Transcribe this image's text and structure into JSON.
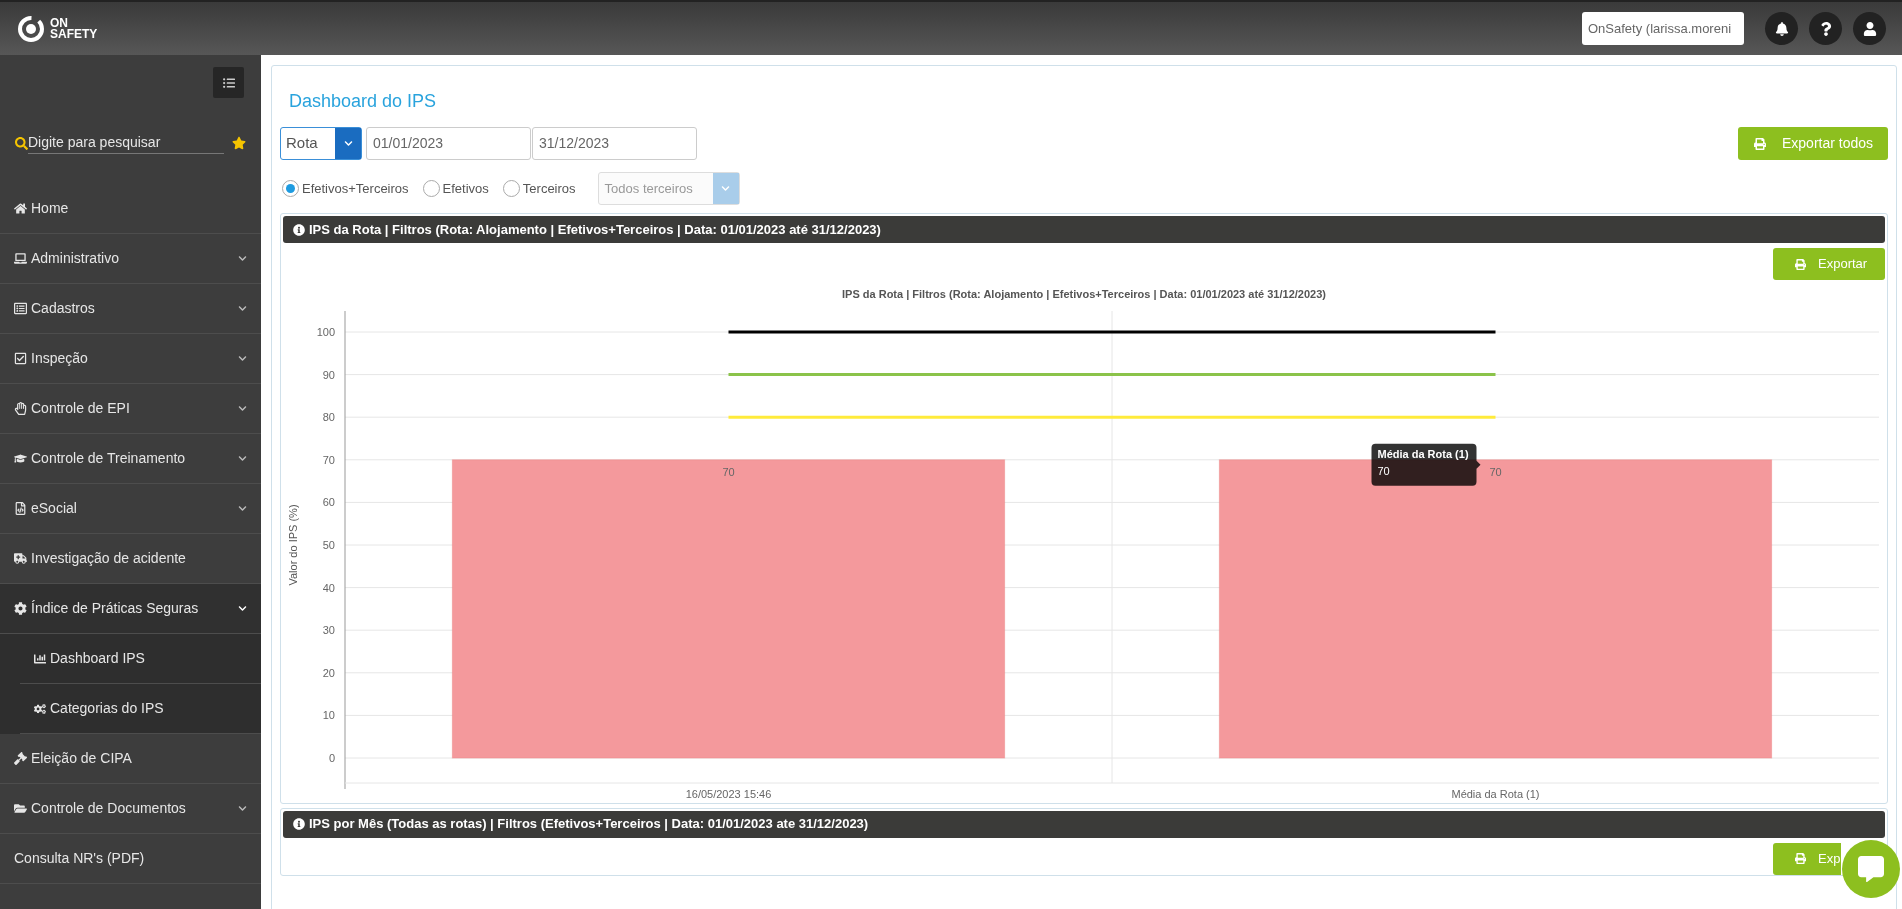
{
  "topbar": {
    "logo_lines": [
      "ON",
      "SAFETY"
    ],
    "user": "OnSafety (larissa.moreni"
  },
  "sidebar": {
    "search": {
      "placeholder": "Digite para pesquisar"
    },
    "items": [
      {
        "label": "Home"
      },
      {
        "label": "Administrativo",
        "expanded": false
      },
      {
        "label": "Cadastros",
        "expanded": false
      },
      {
        "label": "Inspeção",
        "expanded": false
      },
      {
        "label": "Controle de EPI",
        "expanded": false
      },
      {
        "label": "Controle de Treinamento",
        "expanded": false
      },
      {
        "label": "eSocial",
        "expanded": false
      },
      {
        "label": "Investigação de acidente"
      },
      {
        "label": "Índice de Práticas Seguras",
        "expanded": true,
        "children": [
          {
            "label": "Dashboard IPS"
          },
          {
            "label": "Categorias do IPS"
          }
        ]
      },
      {
        "label": "Eleição de CIPA"
      },
      {
        "label": "Controle de Documentos",
        "expanded": false
      },
      {
        "label": "Consulta NR's (PDF)"
      }
    ]
  },
  "page": {
    "title": "Dashboard do IPS",
    "filters": {
      "type": "Rota",
      "date_from": "01/01/2023",
      "date_to": "31/12/2023",
      "radios": [
        {
          "label": "Efetivos+Terceiros",
          "selected": true
        },
        {
          "label": "Efetivos",
          "selected": false
        },
        {
          "label": "Terceiros",
          "selected": false
        }
      ],
      "third_party": {
        "placeholder": "Todos terceiros",
        "disabled": true
      }
    },
    "export_all": "Exportar todos"
  },
  "sections": [
    {
      "header": "IPS da Rota | Filtros (Rota: Alojamento | Efetivos+Terceiros | Data: 01/01/2023 até 31/12/2023)",
      "export": "Exportar",
      "chart_data": {
        "type": "bar",
        "title": "IPS da Rota | Filtros (Rota: Alojamento | Efetivos+Terceiros | Data: 01/01/2023 até 31/12/2023)",
        "ylabel": "Valor do IPS (%)",
        "categories": [
          "16/05/2023 15:46",
          "Média da Rota (1)"
        ],
        "series": [
          {
            "type": "bar",
            "color": "#f4999c",
            "values": [
              70,
              70
            ]
          },
          {
            "type": "line",
            "color": "#000000",
            "values": [
              100,
              100
            ]
          },
          {
            "type": "line",
            "color": "#8bc34a",
            "values": [
              90,
              90
            ]
          },
          {
            "type": "line",
            "color": "#ffeb3b",
            "values": [
              80,
              80
            ]
          }
        ],
        "grid": true,
        "value_labels": [
          [
            "70",
            "70"
          ],
          [
            null,
            null
          ],
          [
            null,
            null
          ],
          [
            null,
            null
          ]
        ],
        "ylim": [
          0,
          100
        ],
        "yticks": [
          0,
          10,
          20,
          30,
          40,
          50,
          60,
          70,
          80,
          90,
          100
        ]
      },
      "tooltip": {
        "title": "Média da Rota (1)",
        "value": "70"
      }
    },
    {
      "header": "IPS por Mês (Todas as rotas) | Filtros (Efetivos+Terceiros | Data: 01/01/2023 ate 31/12/2023)",
      "export": "Exp"
    }
  ]
}
